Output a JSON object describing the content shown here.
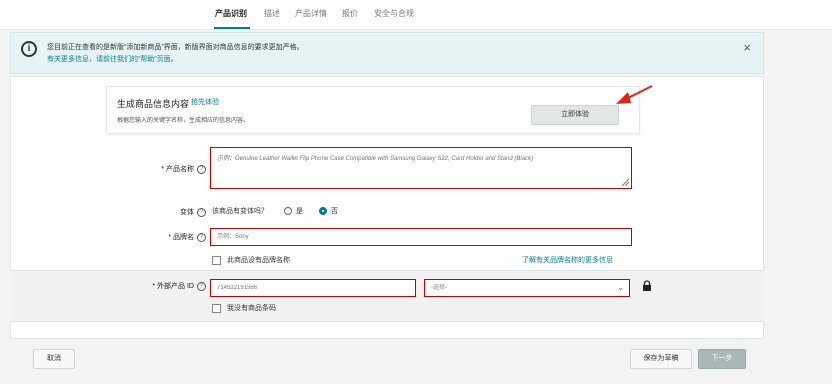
{
  "tabs": [
    {
      "label": "产品识别"
    },
    {
      "label": "描述"
    },
    {
      "label": "产品详情"
    },
    {
      "label": "报价"
    },
    {
      "label": "安全与合规"
    }
  ],
  "notice": {
    "line1": "您目前正在查看的是新版“添加新商品”界面，新版界面对商品信息的要求更加严格。",
    "line2": "有关更多信息，请前往我们的“帮助”页面。"
  },
  "ai_box": {
    "title": "生成商品信息内容",
    "link": "抢先体验",
    "desc": "根据您输入的关键字名称，生成相应的信息内容。",
    "try_label": "立即体验"
  },
  "fields": {
    "product_name_label": "* 产品名称",
    "product_name_placeholder": "示例：Genuine Leather Wallet Flip Phone Case Compatible with Samsung Galaxy S22, Card Holder and Stand (Black)",
    "variant_label": "变体",
    "variant_question": "该商品有变体吗？",
    "variant_yes": "是",
    "variant_no": "否",
    "brand_label": "* 品牌名",
    "brand_placeholder": "示例：Sony",
    "no_brand_label": "此商品没有品牌名称",
    "brand_link": "了解有关品牌名称的更多信息",
    "external_id_label": "* 外部产品 ID",
    "external_id_value": "714532191586",
    "select_placeholder": "-选择-",
    "no_barcode_label": "我没有商品条码"
  },
  "footer": {
    "cancel": "取消",
    "save_draft": "保存为草稿",
    "next": "下一步"
  }
}
